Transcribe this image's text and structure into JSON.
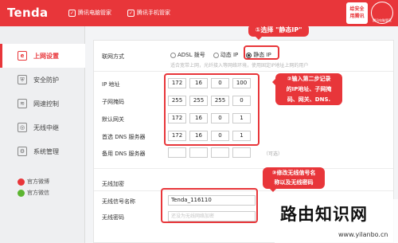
{
  "header": {
    "brand": "Tenda",
    "link1": "腾讯电脑管家",
    "link2": "腾讯手机管家",
    "badge_line1": "给安全",
    "badge_line2": "用腾讯",
    "circle_label": "腾讯电脑管家"
  },
  "sidebar": {
    "items": [
      {
        "label": "上网设置",
        "icon": "globe-icon",
        "glyph": "e"
      },
      {
        "label": "安全防护",
        "icon": "shield-icon",
        "glyph": "⛨"
      },
      {
        "label": "网速控制",
        "icon": "speed-icon",
        "glyph": "≋"
      },
      {
        "label": "无线中继",
        "icon": "wifi-icon",
        "glyph": "◎"
      },
      {
        "label": "系统管理",
        "icon": "gear-icon",
        "glyph": "⚙"
      }
    ],
    "weibo": "官方微博",
    "wechat": "官方微信"
  },
  "form": {
    "conn_label": "联网方式",
    "options": [
      "ADSL 拨号",
      "动态 IP",
      "静态 IP"
    ],
    "selected": "静态 IP",
    "hint": "适合宽带上网，光纤接入等网络环境，使用固定IP地址上网的用户",
    "ip_label": "IP 地址",
    "ip": [
      "172",
      "16",
      "0",
      "100"
    ],
    "mask_label": "子网掩码",
    "mask": [
      "255",
      "255",
      "255",
      "0"
    ],
    "gw_label": "默认网关",
    "gw": [
      "172",
      "16",
      "0",
      "1"
    ],
    "dns1_label": "首选 DNS 服务器",
    "dns1": [
      "172",
      "16",
      "0",
      "1"
    ],
    "dns2_label": "备用 DNS 服务器",
    "dns2": [
      "",
      "",
      "",
      ""
    ],
    "optional": "（可选）",
    "wireless_title": "无线加密",
    "ssid_label": "无线信号名称",
    "ssid": "Tenda_116110",
    "pwd_label": "无线密码",
    "pwd_placeholder": "还没为无线网络加密"
  },
  "annotations": {
    "a1": "①选择 \"静态IP\"",
    "a2_l1": "②输入第二步记录",
    "a2_l2": "的IP地址、子网掩",
    "a2_l3": "码、网关、DNS.",
    "a3_l1": "③修改无线信号名",
    "a3_l2": "称以及无线密码"
  },
  "watermark": {
    "title": "路由知识网",
    "url": "www.yilanbo.cn"
  },
  "colors": {
    "accent": "#e8363a"
  }
}
